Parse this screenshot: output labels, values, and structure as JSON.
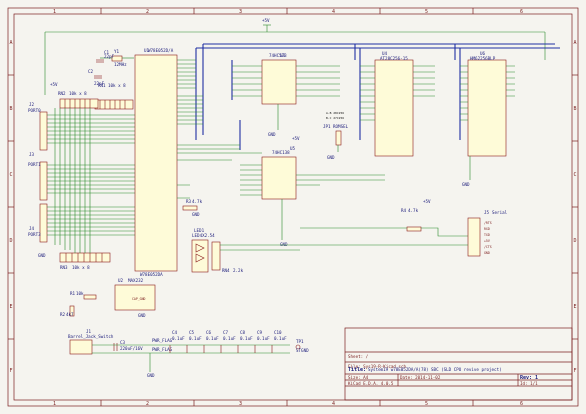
{
  "power": {
    "vcc": "+5V",
    "gnd": "GND"
  },
  "border": {
    "cols_top": [
      "1",
      "2",
      "3",
      "4",
      "5",
      "6"
    ],
    "cols_bottom": [
      "1",
      "2",
      "3",
      "4",
      "5",
      "6"
    ],
    "rows": [
      "A",
      "B",
      "C",
      "D",
      "E",
      "F"
    ]
  },
  "components": {
    "xtal": {
      "ref": "Y1",
      "value": "12MHz"
    },
    "c_xtal_1": {
      "ref": "C1",
      "value": "22pF"
    },
    "c_xtal_2": {
      "ref": "C2",
      "value": "22pF"
    },
    "rn1": {
      "ref": "RN1",
      "value": "10k x 8"
    },
    "rn2": {
      "ref": "RN2",
      "value": "10k x 8"
    },
    "rn3": {
      "ref": "RN3",
      "value": "10k x 8"
    },
    "mcu": {
      "ref": "U1",
      "value": "W78E052D/A",
      "bottom": "W78E052DA"
    },
    "j2": {
      "ref": "J2",
      "value": "PORT0"
    },
    "j3": {
      "ref": "J3",
      "value": "PORT1"
    },
    "j4": {
      "ref": "J4",
      "value": "PORT3"
    },
    "latch": {
      "ref": "U3",
      "value": "74HC573"
    },
    "decoder": {
      "ref": "U5",
      "value": "74HC138"
    },
    "eeprom": {
      "ref": "U4",
      "value": "AT28C256-15"
    },
    "sram": {
      "ref": "U6",
      "value": "HM62256BLP"
    },
    "jumper": {
      "ref": "JP1",
      "value": "ROMSEL",
      "note1": "A-B 28C256",
      "note2": "B-C 27C256"
    },
    "r_led": {
      "ref": "R3",
      "value": "4.7k"
    },
    "r_uart": {
      "ref": "R4",
      "value": "4.7k"
    },
    "leds": {
      "ref": "LED1",
      "value": "LED4X2.54"
    },
    "r_net": {
      "ref": "RN4",
      "value": "2.2k"
    },
    "serial": {
      "ref": "J5",
      "value": "Serial",
      "pins": [
        "/RTS",
        "RXD",
        "TXD",
        "+5V",
        "/CTS",
        "GND"
      ]
    },
    "rs232": {
      "ref": "U2",
      "value": "MAX232",
      "sub": "CAP_GND"
    },
    "r1": {
      "ref": "R1",
      "value": "10k"
    },
    "r2": {
      "ref": "R2",
      "value": "4k7"
    },
    "barrel": {
      "ref": "J1",
      "value": "Barrel_Jack_Switch"
    },
    "c_bulk": {
      "ref": "C3",
      "value": "220uF/16V"
    },
    "pwr_flag_1": {
      "value": "PWR_FLAG"
    },
    "pwr_flag_2": {
      "value": "PWR_FLAG"
    },
    "decoupling": [
      {
        "ref": "C4",
        "value": "0.1uF"
      },
      {
        "ref": "C5",
        "value": "0.1uF"
      },
      {
        "ref": "C6",
        "value": "0.1uF"
      },
      {
        "ref": "C7",
        "value": "0.1uF"
      },
      {
        "ref": "C8",
        "value": "0.1uF"
      },
      {
        "ref": "C9",
        "value": "0.1uF"
      },
      {
        "ref": "C10",
        "value": "0.1uF"
      }
    ],
    "tp": {
      "ref": "TP1",
      "value": "STGND"
    }
  },
  "title_block": {
    "sheet_label": "Sheet: /",
    "file_label": "File: Sys19-R-Kicad.sch",
    "title_label": "Title:",
    "title_value": "System19 w78E052DA/A(78) SBC (SLD CPU revive project)",
    "size_label": "Size: A4",
    "date_label": "Date: 2014-11-02",
    "rev_label": "Rev: 1",
    "kicad_label": "KiCad E.D.A. 4.0.5",
    "id_label": "Id: 1/1"
  }
}
